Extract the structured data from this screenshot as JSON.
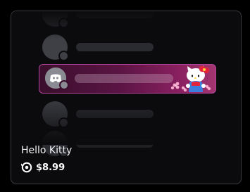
{
  "item": {
    "name": "Hello Kitty",
    "price": "$8.99",
    "currency_icon": "orb-icon"
  },
  "preview": {
    "avatar_icon": "discord-logo-icon",
    "decoration": "hello-kitty-character"
  },
  "colors": {
    "card_background": "#0b0b0d",
    "card_border": "#3a3b40",
    "banner_border": "#b0459b",
    "banner_gradient_start": "#3a0f2c",
    "banner_gradient_end": "#a33670"
  }
}
